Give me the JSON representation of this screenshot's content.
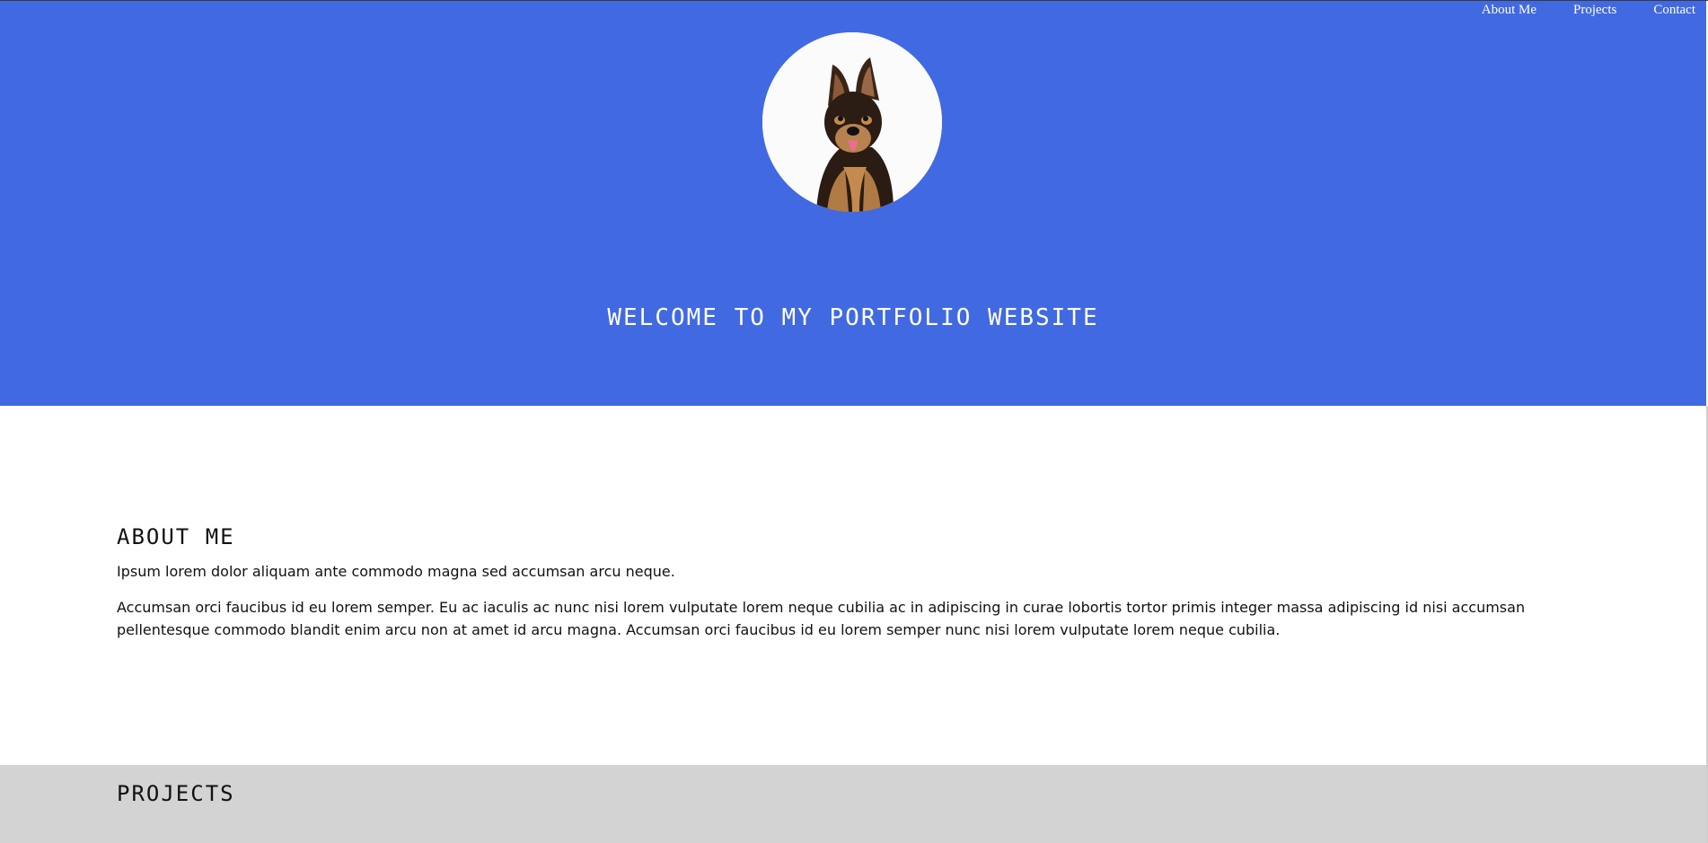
{
  "nav": {
    "items": [
      {
        "label": "About Me"
      },
      {
        "label": "Projects"
      },
      {
        "label": "Contact"
      }
    ]
  },
  "hero": {
    "title": "WELCOME TO MY PORTFOLIO WEBSITE",
    "background": "#4169e1",
    "avatar_icon": "dog-photo"
  },
  "about": {
    "heading": "ABOUT ME",
    "paragraphs": [
      "Ipsum lorem dolor aliquam ante commodo magna sed accumsan arcu neque.",
      "Accumsan orci faucibus id eu lorem semper. Eu ac iaculis ac nunc nisi lorem vulputate lorem neque cubilia ac in adipiscing in curae lobortis tortor primis integer massa adipiscing id nisi accumsan pellentesque commodo blandit enim arcu non at amet id arcu magna. Accumsan orci faucibus id eu lorem semper nunc nisi lorem vulputate lorem neque cubilia."
    ]
  },
  "projects": {
    "heading": "PROJECTS",
    "background": "#d3d3d3"
  }
}
